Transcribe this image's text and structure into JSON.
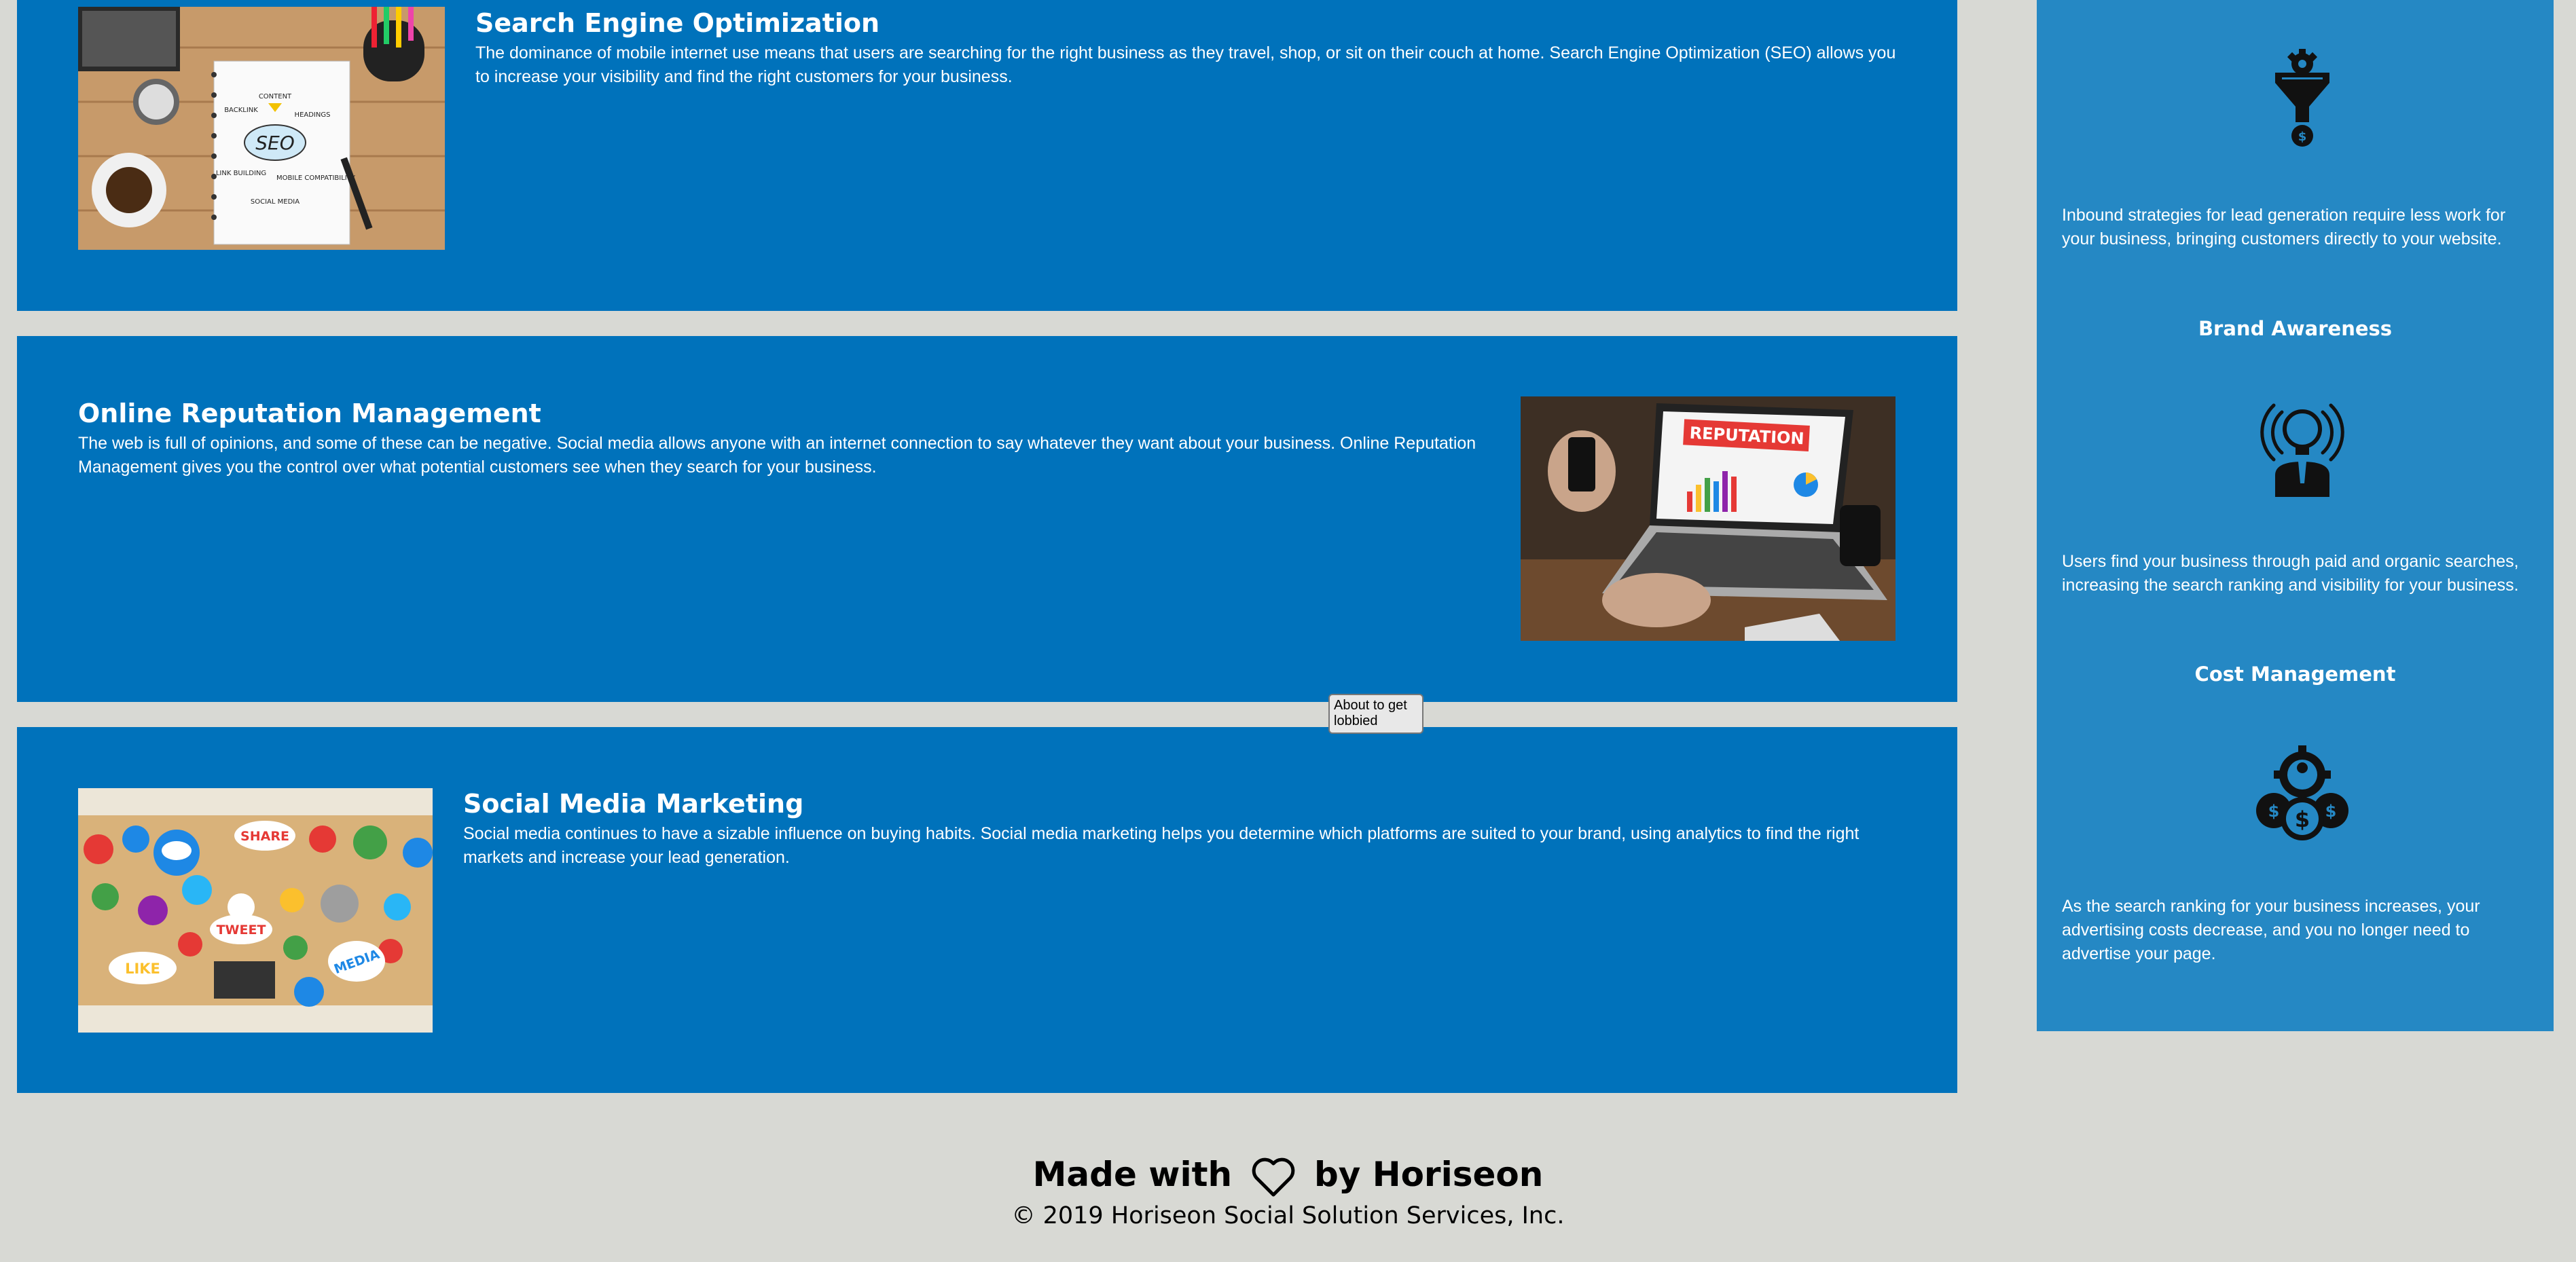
{
  "content": {
    "seo": {
      "title": "Search Engine Optimization",
      "text": "The dominance of mobile internet use means that users are searching for the right business as they travel, shop, or sit on their couch at home. Search Engine Optimization (SEO) allows you to increase your visibility and find the right customers for your business.",
      "image_words": [
        "SEO",
        "BACKLINK",
        "CONTENT",
        "HEADINGS",
        "LINK BUILDING",
        "MOBILE COMPATIBILITY",
        "SOCIAL MEDIA"
      ]
    },
    "reputation": {
      "title": "Online Reputation Management",
      "text": "The web is full of opinions, and some of these can be negative. Social media allows anyone with an internet connection to say whatever they want about your business. Online Reputation Management gives you the control over what potential customers see when they search for your business.",
      "image_words": [
        "REPUTATION"
      ]
    },
    "social": {
      "title": "Social Media Marketing",
      "text": "Social media continues to have a sizable influence on buying habits. Social media marketing helps you determine which platforms are suited to your brand, using analytics to find the right markets and increase your lead generation.",
      "image_words": [
        "SHARE",
        "TWEET",
        "LIKE",
        "MEDIA"
      ]
    }
  },
  "benefits": {
    "lead": {
      "icon": "lead-funnel-icon",
      "text": "Inbound strategies for lead generation require less work for your business, bringing customers directly to your website."
    },
    "brand": {
      "title": "Brand Awareness",
      "icon": "brand-awareness-icon",
      "text": "Users find your business through paid and organic searches, increasing the search ranking and visibility for your business."
    },
    "cost": {
      "title": "Cost Management",
      "icon": "cost-management-icon",
      "text": "As the search ranking for your business increases, your advertising costs decrease, and you no longer need to advertise your page."
    }
  },
  "tooltip": {
    "text": "About to get lobbied"
  },
  "footer": {
    "made_with": "Made with",
    "by": "by Horiseon",
    "heart_icon": "heart-icon",
    "copyright": "© 2019 Horiseon Social Solution Services, Inc."
  },
  "colors": {
    "page_background": "#d8d9d4",
    "content_panel": "#0072bb",
    "benefits_panel": "#2588c4"
  }
}
